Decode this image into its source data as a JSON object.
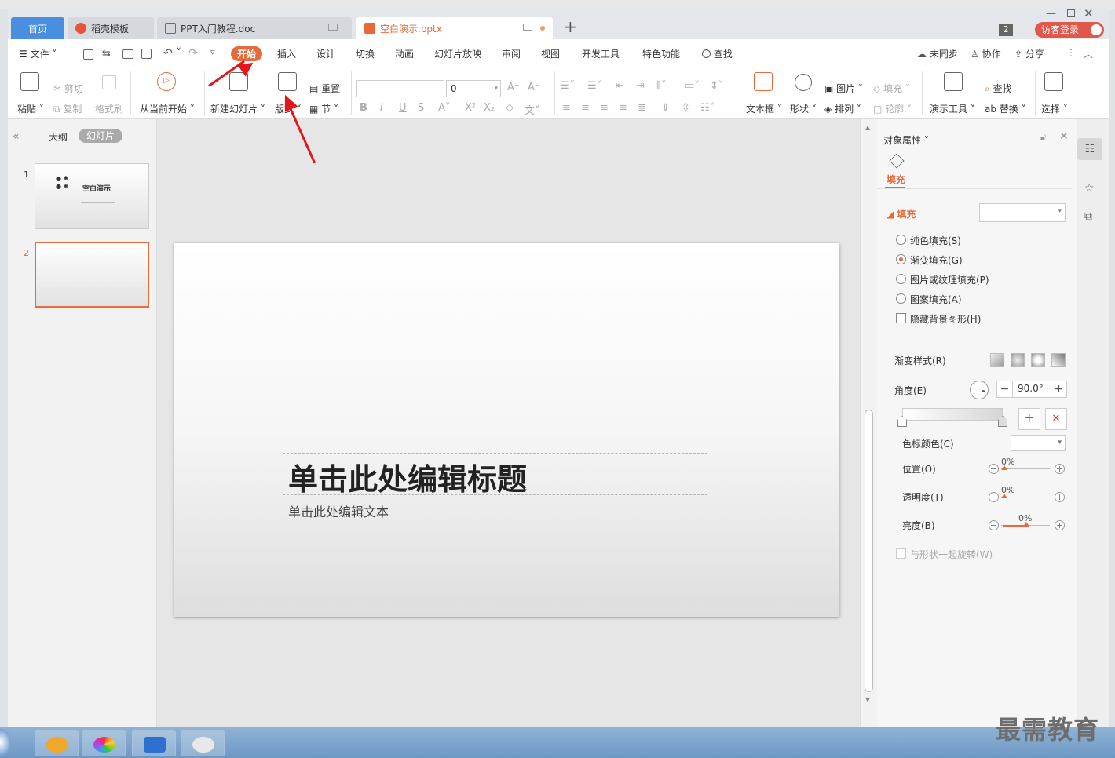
{
  "colors": {
    "accent": "#e8693a",
    "home_tab": "#4a8ee0",
    "arrow": "#e2161c"
  },
  "tabs": [
    {
      "label": "首页",
      "icon": "home-tab"
    },
    {
      "label": "稻壳模板",
      "icon": "docer-icon"
    },
    {
      "label": "PPT入门教程.doc",
      "icon": "word-doc-icon"
    },
    {
      "label": "空白演示.pptx",
      "icon": "ppt-doc-icon"
    }
  ],
  "window_badge": "2",
  "login_label": "访客登录",
  "menu": {
    "file": "文件",
    "items": [
      "开始",
      "插入",
      "设计",
      "切换",
      "动画",
      "幻灯片放映",
      "审阅",
      "视图",
      "开发工具",
      "特色功能"
    ],
    "search": "查找",
    "unsync": "未同步",
    "collab": "协作",
    "share": "分享"
  },
  "ribbon": {
    "paste": "粘贴",
    "cut": "剪切",
    "copy": "复制",
    "format_painter": "格式刷",
    "from_current": "从当前开始",
    "new_slide": "新建幻灯片",
    "layout": "版式",
    "reset": "重置",
    "section": "节",
    "font_size": "0",
    "textbox": "文本框",
    "shape": "形状",
    "picture": "图片",
    "fill": "填充",
    "arrange": "排列",
    "outline": "轮廓",
    "present_tools": "演示工具",
    "find": "查找",
    "replace": "替换",
    "select": "选择"
  },
  "left_panel": {
    "outline_tab": "大纲",
    "slides_tab": "幻灯片",
    "slide_numbers": [
      "1",
      "2"
    ],
    "thumb1_title": "空白演示"
  },
  "slide": {
    "title_placeholder": "单击此处编辑标题",
    "subtitle_placeholder": "单击此处编辑文本"
  },
  "right_panel": {
    "title": "对象属性",
    "fill_tab": "填充",
    "fill_section": "填充",
    "options": [
      "纯色填充(S)",
      "渐变填充(G)",
      "图片或纹理填充(P)",
      "图案填充(A)"
    ],
    "selected_option": "渐变填充(G)",
    "hide_bg": "隐藏背景图形(H)",
    "gradient_style": "渐变样式(R)",
    "angle_label": "角度(E)",
    "angle_value": "90.0°",
    "stop_color": "色标颜色(C)",
    "position_label": "位置(O)",
    "position_value": "0%",
    "transparency_label": "透明度(T)",
    "transparency_value": "0%",
    "brightness_label": "亮度(B)",
    "brightness_value": "0%",
    "rotate_with_shape": "与形状一起旋转(W)"
  },
  "watermark": "最需教育"
}
